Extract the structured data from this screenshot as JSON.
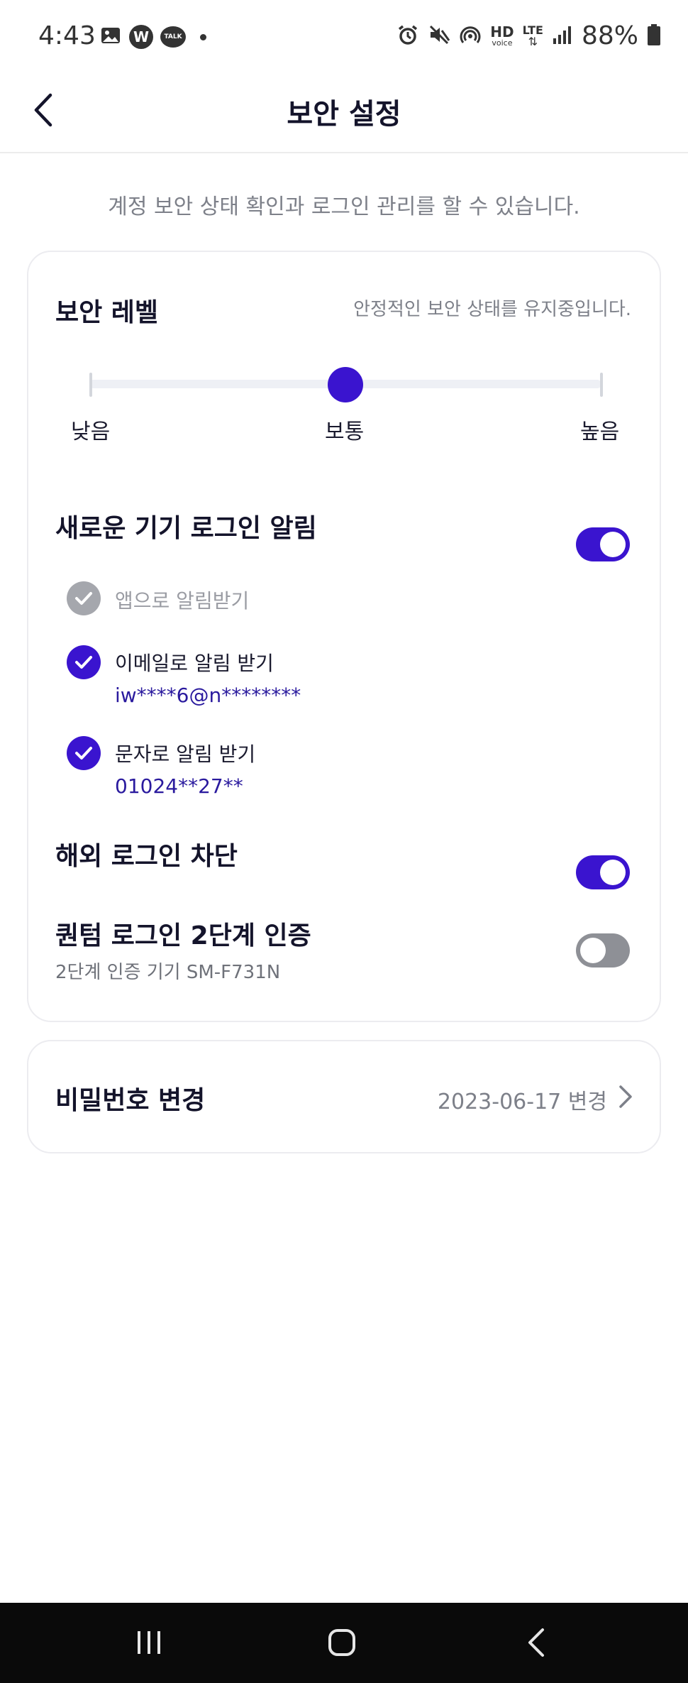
{
  "status_bar": {
    "time": "4:43",
    "battery_text": "88%",
    "icons_left": [
      "gallery-icon",
      "w-app-icon",
      "talk-icon",
      "dot-icon"
    ],
    "icons_right": [
      "alarm-icon",
      "mute-icon",
      "hotspot-icon",
      "hd-voice-icon",
      "lte-icon",
      "signal-icon",
      "battery-icon"
    ],
    "hd_label": "HD",
    "hd_sub": "voice",
    "lte_label": "LTE",
    "w_label": "W",
    "talk_label": "TALK"
  },
  "header": {
    "title": "보안 설정"
  },
  "subtitle": "계정 보안 상태 확인과 로그인 관리를 할 수 있습니다.",
  "security_level": {
    "title": "보안 레벨",
    "status": "안정적인 보안 상태를 유지중입니다.",
    "labels": [
      "낮음",
      "보통",
      "높음"
    ],
    "selected": "보통",
    "level_fraction": 0.5
  },
  "new_device_alert": {
    "title": "새로운 기기 로그인 알림",
    "enabled": true,
    "options": [
      {
        "label": "앱으로 알림받기",
        "checked": true,
        "disabled": true
      },
      {
        "label": "이메일로 알림 받기",
        "value": "iw****6@n********",
        "checked": true
      },
      {
        "label": "문자로 알림 받기",
        "value": "01024**27**",
        "checked": true
      }
    ]
  },
  "overseas_block": {
    "title": "해외 로그인 차단",
    "enabled": true
  },
  "two_factor": {
    "title": "퀀텀 로그인 2단계 인증",
    "detail": "2단계 인증 기기 SM-F731N",
    "enabled": false
  },
  "password": {
    "title": "비밀번호 변경",
    "date": "2023-06-17 변경"
  },
  "colors": {
    "accent": "#3a14cf",
    "muted_text": "#7d8089",
    "toggle_off": "#8e9096",
    "value_text": "#2a1a9e"
  }
}
